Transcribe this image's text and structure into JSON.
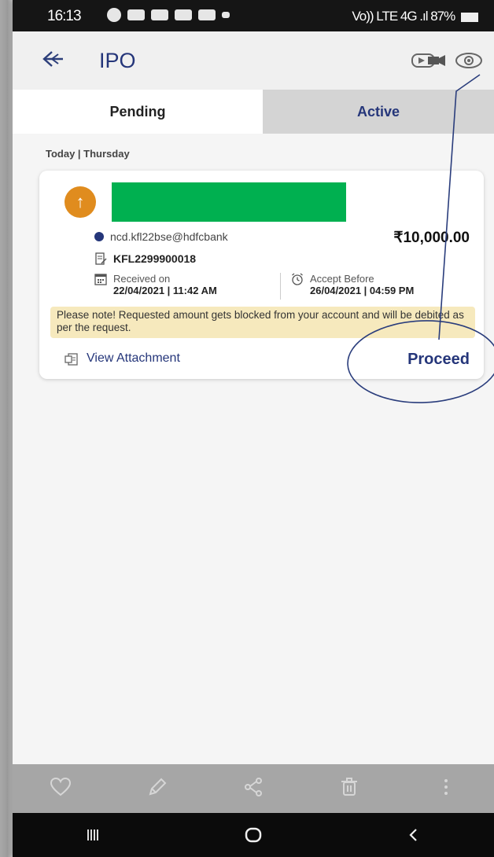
{
  "status_bar": {
    "time": "16:13",
    "right_text": "Vo)) LTE 4G .ıl 87%"
  },
  "app_bar": {
    "title": "IPO"
  },
  "tabs": [
    {
      "label": "Pending",
      "selected": true
    },
    {
      "label": "Active",
      "selected": false
    }
  ],
  "section": {
    "heading": "Today | Thursday"
  },
  "card": {
    "vpa": "ncd.kfl22bse@hdfcbank",
    "amount": "₹10,000.00",
    "reference": "KFL2299900018",
    "received_label": "Received on",
    "received_value": "22/04/2021 | 11:42 AM",
    "accept_label": "Accept Before",
    "accept_value": "26/04/2021 | 04:59 PM",
    "note": "Please note! Requested amount gets blocked from your account and will be debited as per the request.",
    "attachment_label": "View Attachment",
    "proceed_label": "Proceed"
  },
  "colors": {
    "brand_blue": "#25367a",
    "badge_orange": "#e08c1e",
    "redaction_green": "#00b050",
    "note_bg": "#f6e9bd"
  },
  "icons": {
    "back": "double-arrow-left-icon",
    "video": "video-camera-icon",
    "eye": "eye-icon",
    "up": "arrow-up-icon",
    "vpa": "bank-id-icon",
    "reference": "document-edit-icon",
    "calendar": "calendar-icon",
    "alarm": "alarm-clock-icon",
    "attachment": "attachment-icon",
    "favourite": "heart-icon",
    "edit": "pencil-icon",
    "share": "share-icon",
    "delete": "trash-icon",
    "more": "more-vertical-icon",
    "nav_recent": "recent-apps-icon",
    "nav_home": "home-icon",
    "nav_back": "back-icon"
  }
}
